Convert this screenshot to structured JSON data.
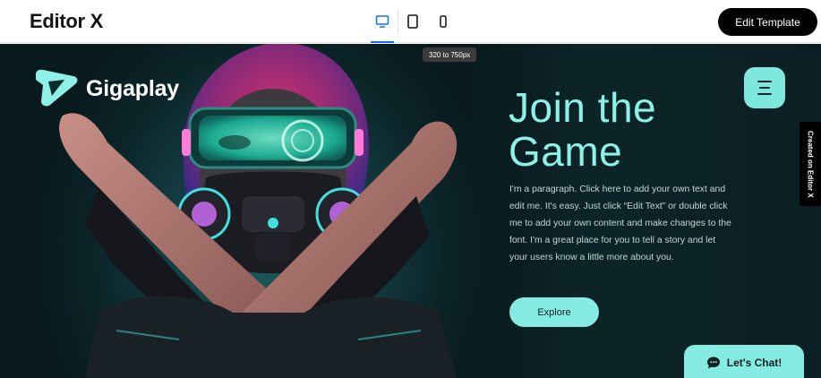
{
  "editor": {
    "brand": "Editor X",
    "edit_button": "Edit Template",
    "devices": [
      "desktop-icon",
      "tablet-icon",
      "mobile-icon"
    ],
    "breakpoint_tooltip": "320 to 750px",
    "accent": "#116dff"
  },
  "site": {
    "logo_text": "Gigaplay",
    "heading_line1": "Join the",
    "heading_line2": "Game",
    "paragraph": "I'm a paragraph. Click here to add your own text and edit me. It's easy. Just click “Edit Text” or double click me to add your own content and make changes to the font. I'm a great place for you to tell a story and let your users know a little more about you.",
    "explore_button": "Explore",
    "chat_button": "Let's Chat!",
    "accent": "#86ece3",
    "heading_color": "#8ef1e8"
  },
  "badge": {
    "created_on": "Created on Editor X"
  }
}
